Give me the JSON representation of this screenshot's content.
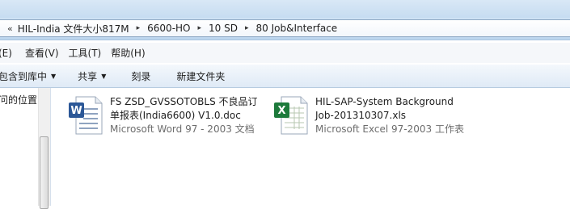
{
  "address": {
    "overflow_glyph": "«",
    "crumbs": [
      "HIL-India 文件大小817M",
      "6600-HO",
      "10 SD",
      "80 Job&Interface"
    ],
    "separator_glyph": "▸"
  },
  "menu": [
    "(E)",
    "查看(V)",
    "工具(T)",
    "帮助(H)"
  ],
  "commands": {
    "include": "包含到库中",
    "share": "共享",
    "burn": "刻录",
    "new_folder": "新建文件夹",
    "dropdown_glyph": "▼"
  },
  "nav": {
    "label": "问的位置"
  },
  "files": [
    {
      "name_line1": "FS ZSD_GVSSOTOBLS 不良品订",
      "name_line2": "单报表(India6600) V1.0.doc",
      "type": "Microsoft Word 97 - 2003 文档",
      "icon": "word-document-icon",
      "accent": "#2b5797"
    },
    {
      "name_line1": "HIL-SAP-System Background",
      "name_line2": "Job-201310307.xls",
      "type": "Microsoft Excel 97-2003 工作表",
      "icon": "excel-worksheet-icon",
      "accent": "#1d7a3b"
    }
  ]
}
